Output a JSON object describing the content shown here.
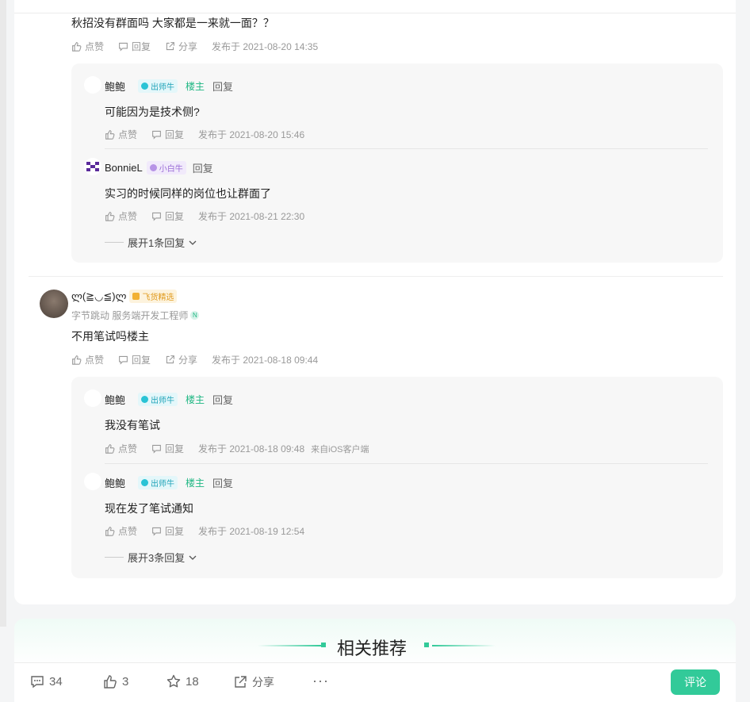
{
  "top_comment": {
    "text": "秋招没有群面吗 大家都是一来就一面？？",
    "like": "点赞",
    "reply": "回复",
    "share": "分享",
    "time": "发布于 2021-08-20 14:35"
  },
  "thread1": [
    {
      "user": "鲍鲍",
      "badge": "出师牛",
      "host": "楼主",
      "reply_word": "回复",
      "text": "可能因为是技术侧?",
      "like": "点赞",
      "reply": "回复",
      "time": "发布于 2021-08-20 15:46"
    },
    {
      "user": "BonnieL",
      "badge": "小白牛",
      "reply_word": "回复",
      "text": "实习的时候同样的岗位也让群面了",
      "like": "点赞",
      "reply": "回复",
      "time": "发布于 2021-08-21 22:30"
    }
  ],
  "thread1_expand": "展开1条回复",
  "comment2": {
    "user": "ლ(≧◡≦)ლ",
    "badge": "飞货精选",
    "company": "字节跳动 服务端开发工程师",
    "text": "不用笔试吗楼主",
    "like": "点赞",
    "reply": "回复",
    "share": "分享",
    "time": "发布于 2021-08-18 09:44"
  },
  "thread2": [
    {
      "user": "鲍鲍",
      "badge": "出师牛",
      "host": "楼主",
      "reply_word": "回复",
      "text": "我没有笔试",
      "like": "点赞",
      "reply": "回复",
      "time": "发布于 2021-08-18 09:48",
      "source": "来自iOS客户端"
    },
    {
      "user": "鲍鲍",
      "badge": "出师牛",
      "host": "楼主",
      "reply_word": "回复",
      "text": "现在发了笔试通知",
      "like": "点赞",
      "reply": "回复",
      "time": "发布于 2021-08-19 12:54"
    }
  ],
  "thread2_expand": "展开3条回复",
  "recommend_title": "相关推荐",
  "bottom_bar": {
    "comments": "34",
    "likes": "3",
    "stars": "18",
    "share": "分享",
    "more": "···",
    "comment_button": "评论"
  },
  "colors": {
    "accent": "#32ca99",
    "teal_badge": "#29c3d5",
    "host_green": "#1fb783"
  }
}
